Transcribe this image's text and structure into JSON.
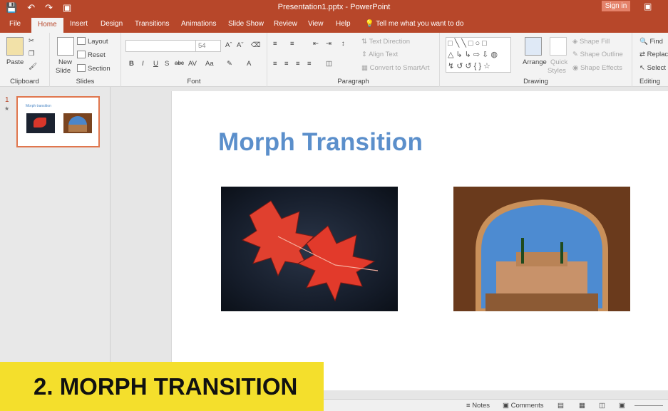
{
  "window": {
    "title": "Presentation1.pptx - PowerPoint",
    "sign_in": "Sign in"
  },
  "tabs": [
    "File",
    "Home",
    "Insert",
    "Design",
    "Transitions",
    "Animations",
    "Slide Show",
    "Review",
    "View",
    "Help"
  ],
  "active_tab": "Home",
  "tell_me": "Tell me what you want to do",
  "ribbon": {
    "clipboard": {
      "label": "Clipboard",
      "paste": "Paste"
    },
    "slides": {
      "label": "Slides",
      "new_slide_1": "New",
      "new_slide_2": "Slide",
      "layout": "Layout",
      "reset": "Reset",
      "section": "Section"
    },
    "font": {
      "label": "Font",
      "size": "54",
      "buttons": [
        "B",
        "I",
        "U",
        "S",
        "abc",
        "AV",
        "Aa",
        "A"
      ]
    },
    "paragraph": {
      "label": "Paragraph",
      "text_direction": "Text Direction",
      "align_text": "Align Text",
      "convert": "Convert to SmartArt"
    },
    "drawing": {
      "label": "Drawing",
      "arrange": "Arrange",
      "quick_styles_1": "Quick",
      "quick_styles_2": "Styles",
      "shape_fill": "Shape Fill",
      "shape_outline": "Shape Outline",
      "shape_effects": "Shape Effects"
    },
    "editing": {
      "label": "Editing",
      "find": "Find",
      "replace": "Replac",
      "select": "Select"
    }
  },
  "thumbnail": {
    "number": "1",
    "star": "★",
    "title": "Morph transition"
  },
  "slide": {
    "title": "Morph Transition"
  },
  "status": {
    "notes": "Notes",
    "comments": "Comments"
  },
  "banner": {
    "text": "2. MORPH TRANSITION"
  },
  "colors": {
    "accent": "#b7472a",
    "title_blue": "#5b8fcb",
    "banner": "#f4df2c",
    "thumb_border": "#e0764d"
  }
}
